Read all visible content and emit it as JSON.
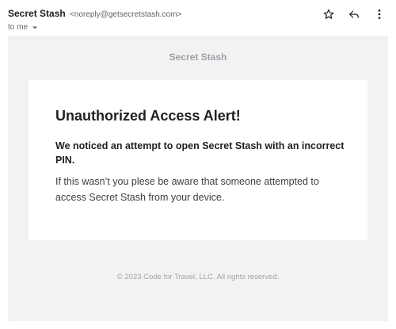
{
  "header": {
    "sender_name": "Secret Stash",
    "sender_email": "<noreply@getsecretstash.com>",
    "to": "to me",
    "icons": [
      "star-icon",
      "reply-icon",
      "more-vert-icon",
      "chevron-down-icon"
    ]
  },
  "email": {
    "brand": "Secret Stash",
    "title": "Unauthorized Access Alert!",
    "strong_text": "We noticed an attempt to open Secret Stash with an incorrect PIN.",
    "body_text": "If this wasn’t you plese be aware that someone attempted to access Secret Stash from your device.",
    "footer": "© 2023 Code for Travel, LLC. All rights reserved."
  },
  "colors": {
    "outer_background": "#f2f2f3",
    "card_background": "#ffffff",
    "brand_text": "#9aa0a6",
    "footer_text": "#a0a4a8"
  }
}
